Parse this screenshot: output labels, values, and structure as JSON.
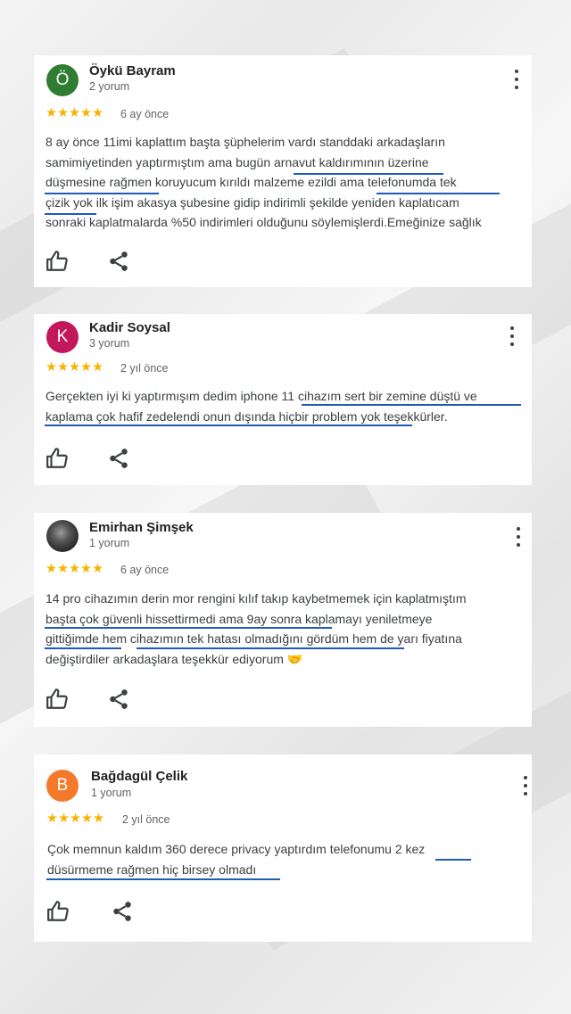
{
  "colors": {
    "star": "#f6b400",
    "underline": "#1f5bb5",
    "avatar_green": "#2e7d32",
    "avatar_magenta": "#c2185b",
    "avatar_orange": "#f4792a"
  },
  "icons": {
    "like": "thumb-up-outline-icon",
    "share": "share-icon",
    "menu": "more-vert-icon"
  },
  "reviews": [
    {
      "avatar_letter": "Ö",
      "name": "Öykü Bayram",
      "count": "2 yorum",
      "stars": "★★★★★",
      "rating": 5,
      "date": "6 ay önce",
      "lines": [
        "8 ay önce 11imi kaplattım başta şüphelerim vardı standdaki arkadaşların",
        "samimiyetinden yaptırmıştım ama bugün arnavut kaldırımının üzerine",
        "düşmesine rağmen koruyucum kırıldı malzeme ezildi ama telefonumda tek",
        "çizik yok ilk işim akasya şubesine gidip indirimli şekilde yeniden kaplatıcam",
        "sonraki kaplatmalarda %50 indirimleri olduğunu söylemişlerdi.Emeğinize sağlık"
      ]
    },
    {
      "avatar_letter": "K",
      "name": "Kadir Soysal",
      "count": "3 yorum",
      "stars": "★★★★★",
      "rating": 5,
      "date": "2 yıl önce",
      "lines": [
        "Gerçekten iyi ki yaptırmışım dedim iphone 11 cihazım sert bir zemine düştü ve",
        "kaplama çok hafif zedelendi onun dışında hiçbir problem yok teşekkürler."
      ]
    },
    {
      "avatar_letter": "",
      "name": "Emirhan Şimşek",
      "count": "1 yorum",
      "stars": "★★★★★",
      "rating": 5,
      "date": "6 ay önce",
      "lines": [
        "14 pro cihazımın derin mor rengini kılıf takıp kaybetmemek için kaplatmıştım",
        "başta çok güvenli hissettirmedi ama 9ay sonra kaplamayı yeniletmeye",
        "gittiğimde hem cihazımın tek hatası olmadığını gördüm hem de yarı fiyatına",
        "değiştirdiler arkadaşlara teşekkür ediyorum 🤝"
      ]
    },
    {
      "avatar_letter": "B",
      "name": "Bağdagül Çelik",
      "count": "1 yorum",
      "stars": "★★★★★",
      "rating": 5,
      "date": "2 yıl önce",
      "lines": [
        "Çok memnun kaldım 360 derece privacy yaptırdım telefonumu 2 kez",
        "düsürmeme rağmen hiç birsey olmadı"
      ]
    }
  ]
}
